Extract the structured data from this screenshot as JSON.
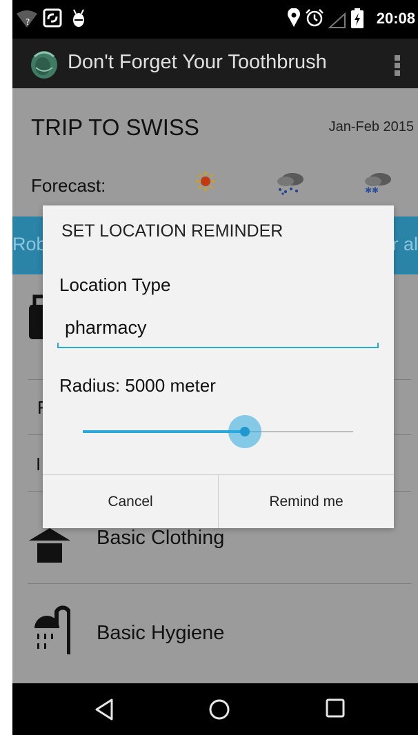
{
  "status_bar": {
    "time": "20:08",
    "left_icons": [
      "wifi-question-icon",
      "sync-app-icon",
      "android-debug-icon"
    ],
    "right_icons": [
      "location-pin-icon",
      "alarm-icon",
      "signal-icon",
      "battery-charging-icon"
    ]
  },
  "action_bar": {
    "title": "Don't Forget Your Toothbrush",
    "logo_icon": "backpack-logo-icon",
    "overflow_icon": "overflow-menu-icon"
  },
  "trip": {
    "title": "TRIP TO SWISS",
    "date": "Jan-Feb 2015",
    "forecast_label": "Forecast:",
    "forecast_icons": [
      "sun-icon",
      "rain-cloud-icon",
      "snow-cloud-icon"
    ]
  },
  "band": {
    "left_text": "Rob",
    "right_text": "r al"
  },
  "list": {
    "partial_rows": [
      "F",
      "I"
    ],
    "items": [
      {
        "label": "Basic Clothing",
        "icon": "hat-icon"
      },
      {
        "label": "Basic Hygiene",
        "icon": "shower-icon"
      }
    ]
  },
  "dialog": {
    "title": "SET LOCATION REMINDER",
    "location_label": "Location Type",
    "location_value": "pharmacy",
    "radius_label": "Radius: 5000 meter",
    "slider_value": 0.6,
    "cancel_label": "Cancel",
    "confirm_label": "Remind me"
  },
  "nav_bar": {
    "icons": [
      "back-icon",
      "home-icon",
      "recents-icon"
    ]
  },
  "colors": {
    "accent": "#2aa8dc",
    "status_bar": "#000000",
    "action_bar": "#1c1c1c",
    "dimmed_background": "#9b9b9b",
    "dialog_background": "#f2f2f2"
  }
}
